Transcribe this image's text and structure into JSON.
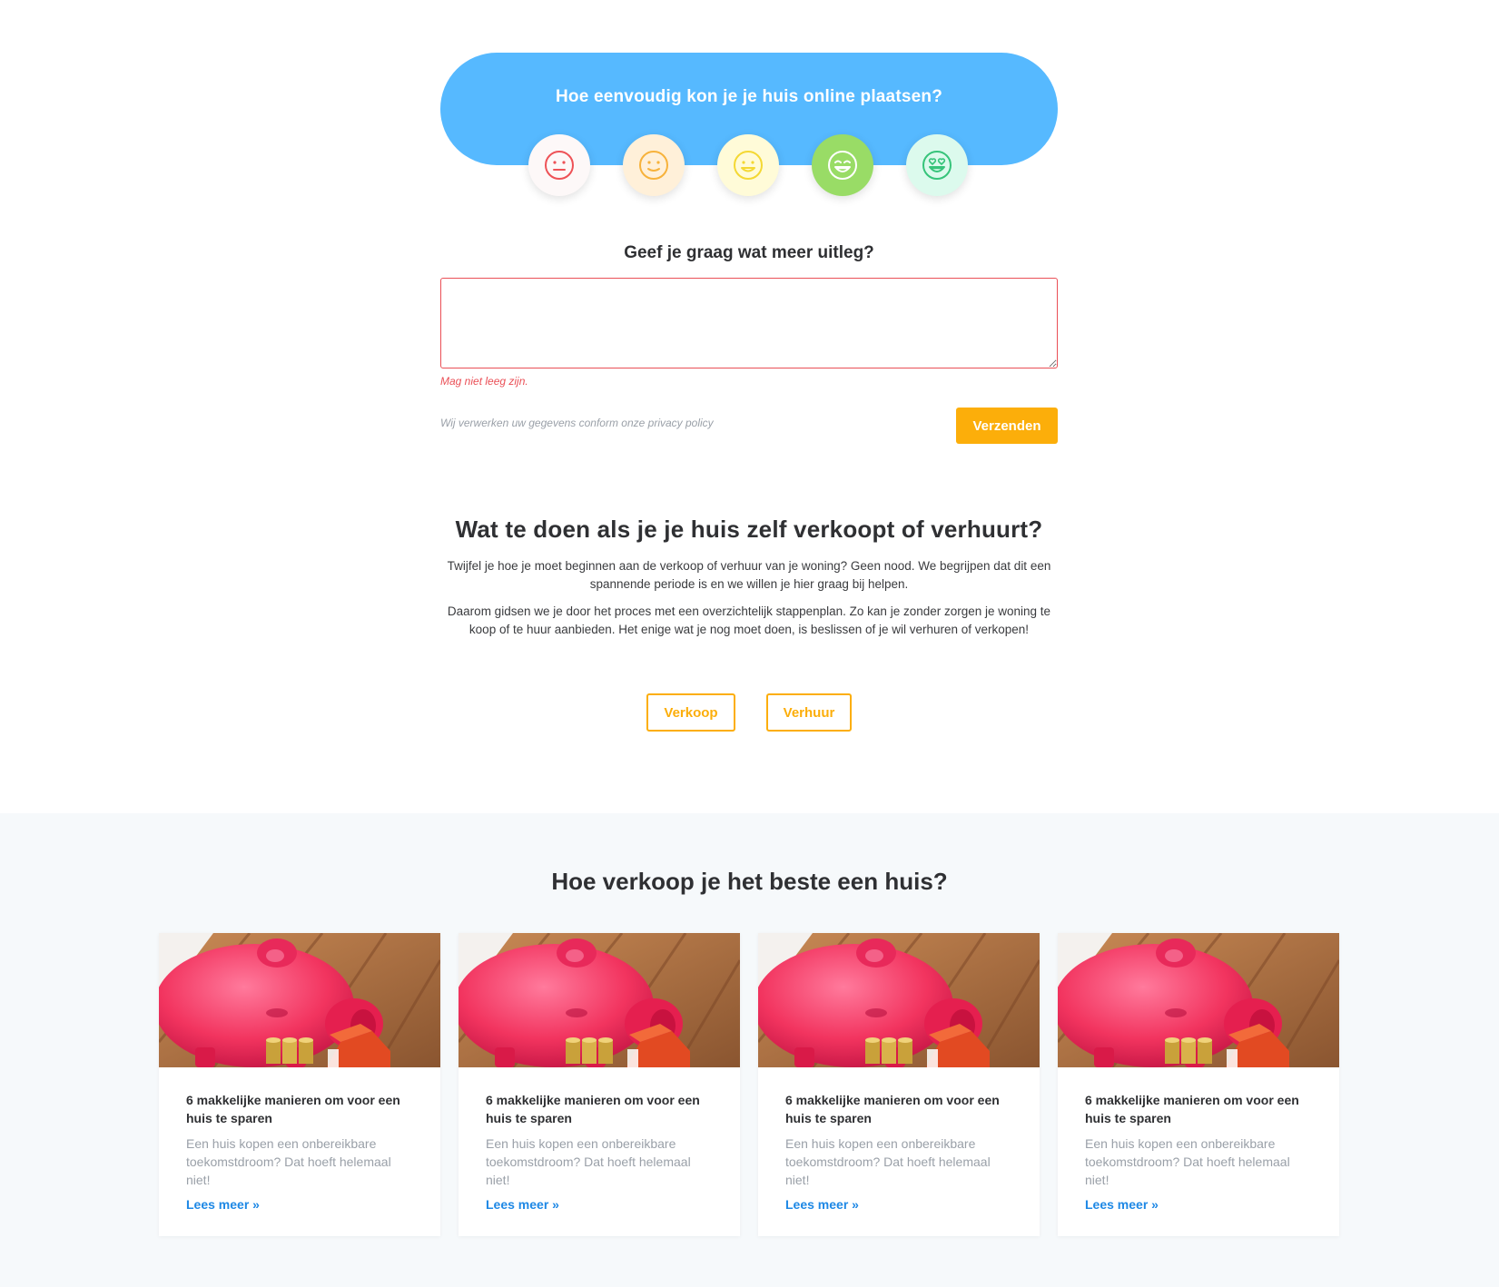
{
  "rating": {
    "question": "Hoe eenvoudig kon je je huis online plaatsen?",
    "faces": [
      {
        "name": "neutral-face-icon",
        "bg": "#fdf8f8",
        "stroke": "#ee5257"
      },
      {
        "name": "slight-smile-face-icon",
        "bg": "#fff0d9",
        "stroke": "#f7b23b"
      },
      {
        "name": "smile-face-icon",
        "bg": "#fffbd8",
        "stroke": "#f4d833"
      },
      {
        "name": "grin-face-icon",
        "bg": "#99dc66",
        "stroke": "#ffffff"
      },
      {
        "name": "heart-eyes-face-icon",
        "bg": "#dcfaed",
        "stroke": "#36c47a"
      }
    ]
  },
  "feedback": {
    "title": "Geef je graag wat meer uitleg?",
    "value": "",
    "error": "Mag niet leeg zijn.",
    "privacy": "Wij verwerken uw gegevens conform onze privacy policy",
    "submit_label": "Verzenden"
  },
  "info": {
    "title": "Wat te doen als je je huis zelf verkoopt of verhuurt?",
    "paragraph1": "Twijfel je hoe je moet beginnen aan de verkoop of verhuur van je woning? Geen nood. We begrijpen dat dit een spannende periode is en we willen je hier graag bij helpen.",
    "paragraph2": "Daarom gidsen we je door het proces met een overzichtelijk stappenplan. Zo kan je zonder zorgen je woning te koop of te huur aanbieden. Het enige wat je nog moet doen, is beslissen of je wil verhuren of verkopen!",
    "sell_label": "Verkoop",
    "rent_label": "Verhuur"
  },
  "articles": {
    "title": "Hoe verkoop je het beste een huis?",
    "cards": [
      {
        "title": "6 makkelijke manieren om voor een huis te sparen",
        "excerpt": "Een huis kopen een onbereikbare toekomstdroom? Dat hoeft helemaal niet!",
        "link": "Lees meer »"
      },
      {
        "title": "6 makkelijke manieren om voor een huis te sparen",
        "excerpt": "Een huis kopen een onbereikbare toekomstdroom? Dat hoeft helemaal niet!",
        "link": "Lees meer »"
      },
      {
        "title": "6 makkelijke manieren om voor een huis te sparen",
        "excerpt": "Een huis kopen een onbereikbare toekomstdroom? Dat hoeft helemaal niet!",
        "link": "Lees meer »"
      },
      {
        "title": "6 makkelijke manieren om voor een huis te sparen",
        "excerpt": "Een huis kopen een onbereikbare toekomstdroom? Dat hoeft helemaal niet!",
        "link": "Lees meer »"
      }
    ]
  },
  "colors": {
    "accent_blue": "#56b9ff",
    "accent_orange": "#fcae0a",
    "error_red": "#ea4f56",
    "link_blue": "#1e88e5"
  }
}
